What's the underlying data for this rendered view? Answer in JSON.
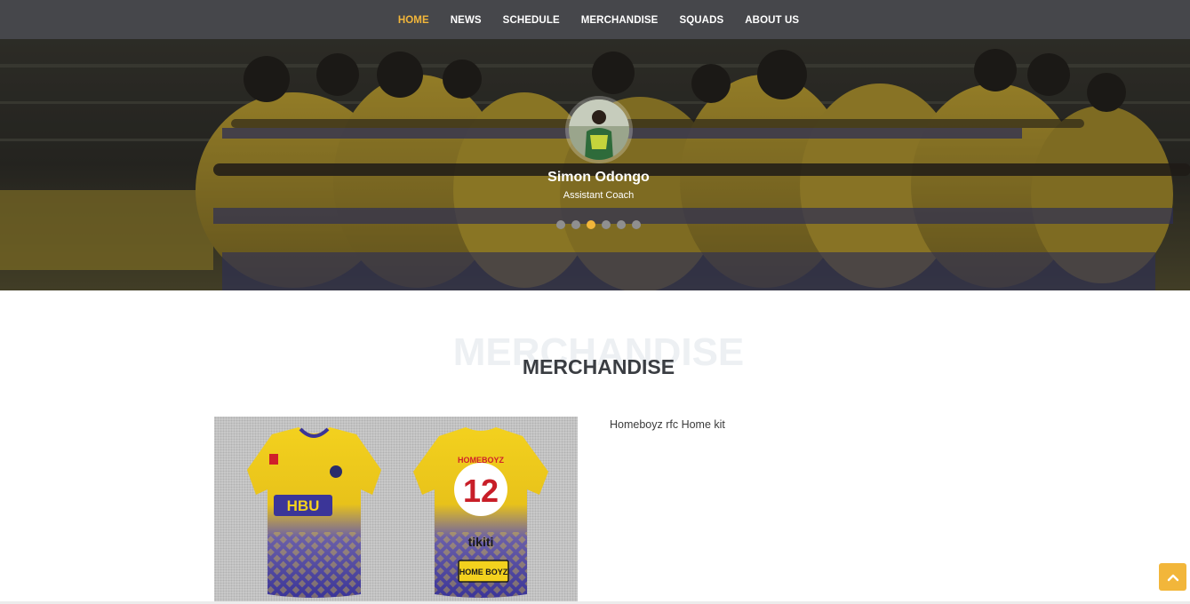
{
  "nav": {
    "items": [
      {
        "label": "HOME",
        "active": true
      },
      {
        "label": "NEWS",
        "active": false
      },
      {
        "label": "SCHEDULE",
        "active": false
      },
      {
        "label": "MERCHANDISE",
        "active": false
      },
      {
        "label": "SQUADS",
        "active": false
      },
      {
        "label": "ABOUT US",
        "active": false
      }
    ],
    "active_color": "#f2b63a",
    "background_color": "#46474b"
  },
  "hero": {
    "image": "team-huddle-photo",
    "slide": {
      "name": "Simon Odongo",
      "role": "Assistant Coach"
    },
    "slide_count": 6,
    "active_slide_index": 2
  },
  "merchandise": {
    "background_title": "MERCHANDISE",
    "title": "MERCHANDISE",
    "product": {
      "image": "home-kit-jersey-front-and-back",
      "description": "Homeboyz rfc Home kit",
      "jersey_front_text": "HBU",
      "jersey_back_number": "12",
      "jersey_back_team": "HOMEBOYZ",
      "jersey_back_sponsor": "tikiti",
      "jersey_back_logo": "HOME BOYZ"
    }
  },
  "back_to_top": {
    "icon": "chevron-up-icon",
    "color": "#f2b63a"
  }
}
